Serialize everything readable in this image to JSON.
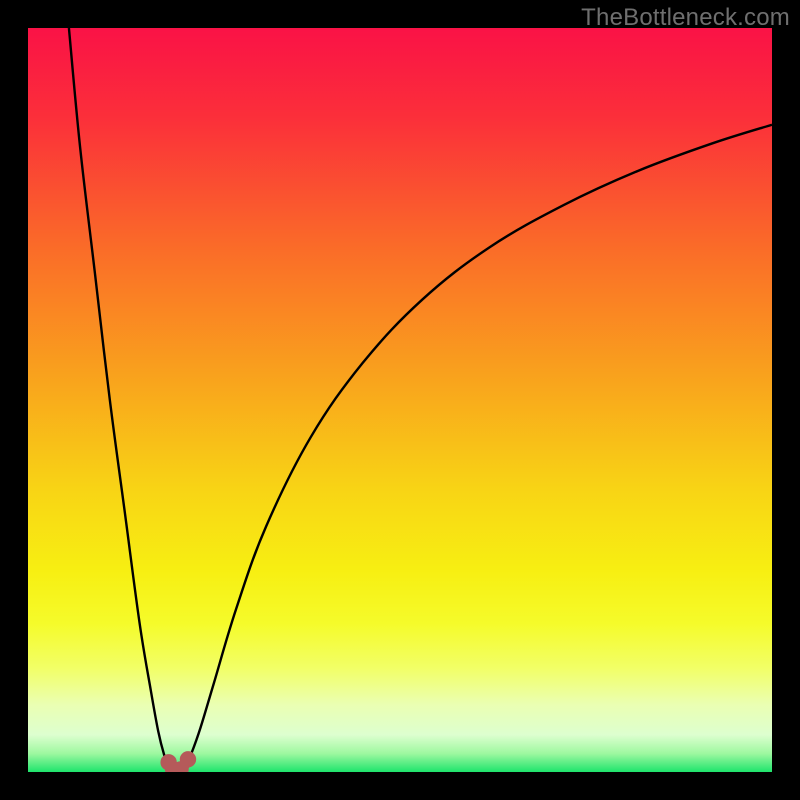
{
  "watermark": "TheBottleneck.com",
  "colors": {
    "black": "#000000",
    "curve": "#000000",
    "marker_fill": "#b55a5a",
    "marker_fill_light": "#c87a7a",
    "gradient_stops": [
      {
        "offset": 0.0,
        "color": "#fa1246"
      },
      {
        "offset": 0.12,
        "color": "#fb2f3a"
      },
      {
        "offset": 0.3,
        "color": "#fa6d28"
      },
      {
        "offset": 0.48,
        "color": "#f9a61c"
      },
      {
        "offset": 0.62,
        "color": "#f8d415"
      },
      {
        "offset": 0.73,
        "color": "#f7ef12"
      },
      {
        "offset": 0.8,
        "color": "#f5fb2a"
      },
      {
        "offset": 0.86,
        "color": "#f2ff66"
      },
      {
        "offset": 0.91,
        "color": "#eaffb3"
      },
      {
        "offset": 0.95,
        "color": "#ddffcf"
      },
      {
        "offset": 0.975,
        "color": "#9ef8a0"
      },
      {
        "offset": 1.0,
        "color": "#1ee46c"
      }
    ]
  },
  "chart_data": {
    "type": "line",
    "title": "",
    "xlabel": "",
    "ylabel": "",
    "xlim": [
      0,
      100
    ],
    "ylim": [
      0,
      100
    ],
    "grid": false,
    "legend": false,
    "series": [
      {
        "name": "left-branch",
        "x": [
          5.5,
          7,
          9,
          11,
          13,
          15,
          16.5,
          17.5,
          18.3,
          18.9,
          19.4
        ],
        "y": [
          100,
          84,
          67,
          50,
          35,
          20,
          11,
          5.5,
          2.3,
          0.8,
          0.15
        ]
      },
      {
        "name": "right-branch",
        "x": [
          20.6,
          21.2,
          22,
          23.2,
          25,
          28,
          32,
          38,
          45,
          53,
          62,
          72,
          82,
          92,
          100
        ],
        "y": [
          0.15,
          0.9,
          2.6,
          6,
          12,
          22,
          33,
          45,
          55,
          63.5,
          70.5,
          76.2,
          80.8,
          84.5,
          87
        ]
      }
    ],
    "markers": [
      {
        "name": "dip-left",
        "x": 18.9,
        "y": 1.3,
        "r": 1.1
      },
      {
        "name": "dip-base-left",
        "x": 19.5,
        "y": 0.35,
        "r": 1.1
      },
      {
        "name": "dip-base-right",
        "x": 20.5,
        "y": 0.35,
        "r": 1.1
      },
      {
        "name": "dip-right",
        "x": 21.5,
        "y": 1.7,
        "r": 1.1
      }
    ],
    "optimum_x": 20
  }
}
